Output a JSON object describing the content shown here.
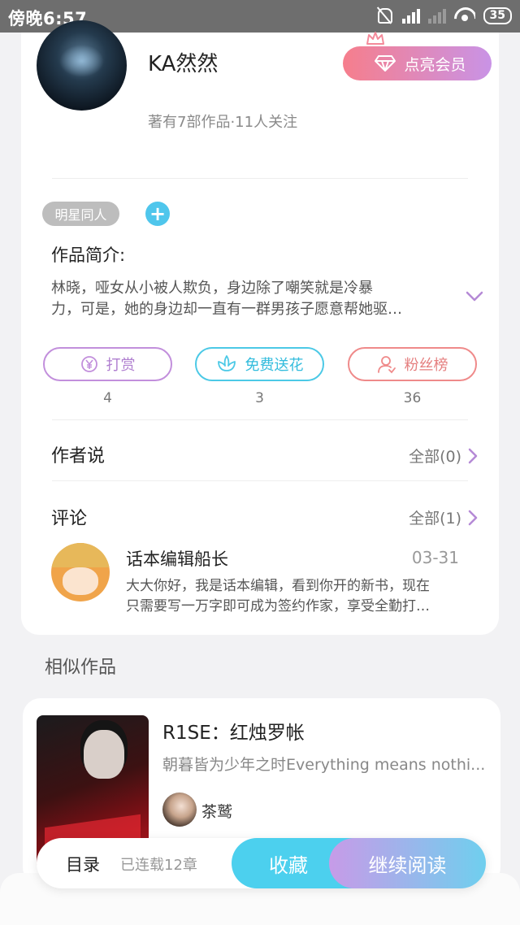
{
  "status_bar": {
    "time": "傍晚6:57",
    "battery": "35"
  },
  "author": {
    "name": "KA然然",
    "stats": "著有7部作品·11人关注",
    "vip_label": "点亮会员"
  },
  "tags": [
    "明星同人"
  ],
  "add_tag_symbol": "+",
  "intro": {
    "heading": "作品简介:",
    "lines": [
      "林晓，哑女从小被人欺负，身边除了嘲笑就是冷暴",
      "力，可是，她的身边却一直有一群男孩子愿意帮她驱…"
    ]
  },
  "actions": {
    "tip": {
      "label": "打赏",
      "count": "4"
    },
    "flower": {
      "label": "免费送花",
      "count": "3"
    },
    "fans": {
      "label": "粉丝榜",
      "count": "36"
    }
  },
  "author_says": {
    "title": "作者说",
    "link": "全部(0)"
  },
  "comments": {
    "title": "评论",
    "link": "全部(1)",
    "items": [
      {
        "user": "话本编辑船长",
        "date": "03-31",
        "lines": [
          "大大你好，我是话本编辑，看到你开的新书，现在",
          "只需要写一万字即可成为签约作家，享受全勤打…"
        ]
      }
    ]
  },
  "similar": {
    "heading": "相似作品",
    "books": [
      {
        "title": "R1SE：红烛罗帐",
        "desc": "朝暮皆为少年之时Everything means nothi...",
        "author": "茶鹫"
      }
    ]
  },
  "bottom_bar": {
    "toc": "目录",
    "status": "已连载12章",
    "collect": "收藏",
    "read": "继续阅读"
  },
  "colors": {
    "accent_blue": "#4cd0ee",
    "vip_gradient_start": "#f67e8c",
    "vip_gradient_end": "#c993e6",
    "tip": "#c28fdc",
    "flower": "#4cc9e6",
    "fans": "#ef8a8a"
  }
}
